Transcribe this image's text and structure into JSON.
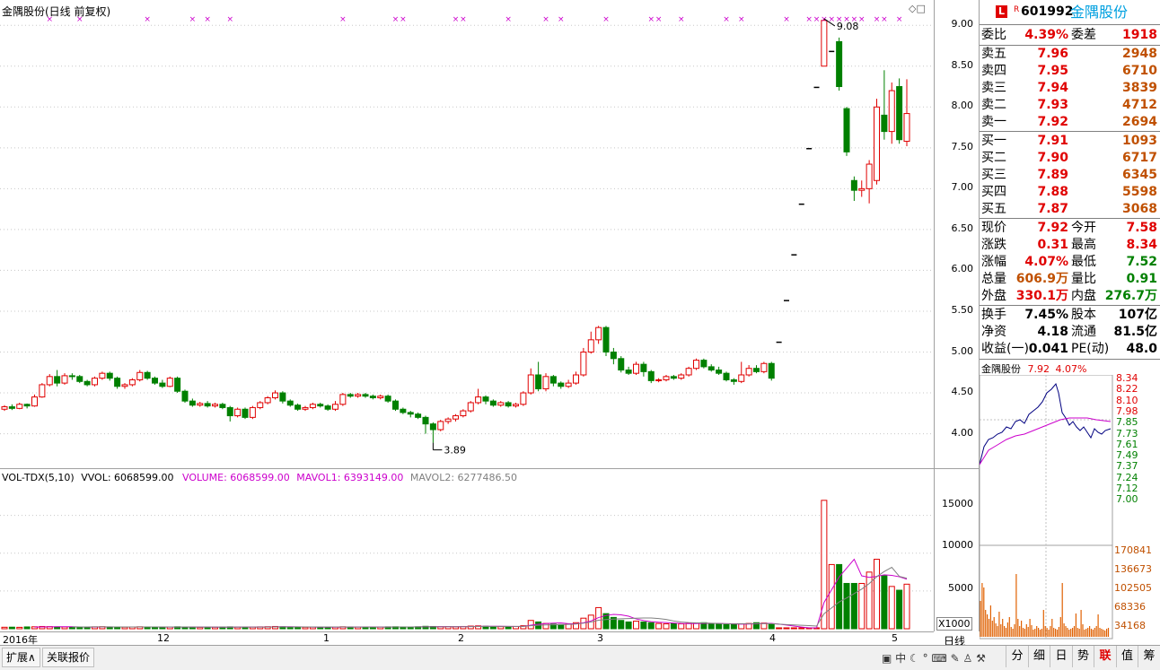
{
  "chart_title": "金隅股份(日线 前复权)",
  "price_axis": [
    "9.00",
    "8.50",
    "8.00",
    "7.50",
    "7.00",
    "6.50",
    "6.00",
    "5.50",
    "5.00",
    "4.50",
    "4.00"
  ],
  "annotations": {
    "high": "9.08",
    "low": "3.89"
  },
  "volume_header": {
    "name": "VOL-TDX(5,10)",
    "vvol": "VVOL: 6068599.00",
    "volume": "VOLUME: 6068599.00",
    "mavol1": "MAVOL1: 6393149.00",
    "mavol2": "MAVOL2: 6277486.50"
  },
  "volume_axis": [
    "15000",
    "10000",
    "5000"
  ],
  "volume_unit": "X1000",
  "date_axis": [
    "2016年",
    "12",
    "1",
    "2",
    "3",
    "4",
    "5"
  ],
  "period_label": "日线",
  "quote": {
    "badge": "L",
    "r_mark": "R",
    "code": "601992",
    "name": "金隅股份",
    "webi_label": "委比",
    "webi": "4.39%",
    "wecha_label": "委差",
    "wecha": "1918",
    "asks": [
      {
        "label": "卖五",
        "price": "7.96",
        "vol": "2948"
      },
      {
        "label": "卖四",
        "price": "7.95",
        "vol": "6710"
      },
      {
        "label": "卖三",
        "price": "7.94",
        "vol": "3839"
      },
      {
        "label": "卖二",
        "price": "7.93",
        "vol": "4712"
      },
      {
        "label": "卖一",
        "price": "7.92",
        "vol": "2694"
      }
    ],
    "bids": [
      {
        "label": "买一",
        "price": "7.91",
        "vol": "1093"
      },
      {
        "label": "买二",
        "price": "7.90",
        "vol": "6717"
      },
      {
        "label": "买三",
        "price": "7.89",
        "vol": "6345"
      },
      {
        "label": "买四",
        "price": "7.88",
        "vol": "5598"
      },
      {
        "label": "买五",
        "price": "7.87",
        "vol": "3068"
      }
    ],
    "stats": [
      {
        "l1": "现价",
        "v1": "7.92",
        "c1": "red",
        "l2": "今开",
        "v2": "7.58",
        "c2": "red"
      },
      {
        "l1": "涨跌",
        "v1": "0.31",
        "c1": "red",
        "l2": "最高",
        "v2": "8.34",
        "c2": "red"
      },
      {
        "l1": "涨幅",
        "v1": "4.07%",
        "c1": "red",
        "l2": "最低",
        "v2": "7.52",
        "c2": "green"
      },
      {
        "l1": "总量",
        "v1": "606.9万",
        "c1": "orange",
        "l2": "量比",
        "v2": "0.91",
        "c2": "green"
      },
      {
        "l1": "外盘",
        "v1": "330.1万",
        "c1": "red",
        "l2": "内盘",
        "v2": "276.7万",
        "c2": "green"
      }
    ],
    "stats2": [
      {
        "l1": "换手",
        "v1": "7.45%",
        "l2": "股本",
        "v2": "107亿"
      },
      {
        "l1": "净资",
        "v1": "4.18",
        "l2": "流通",
        "v2": "81.5亿"
      },
      {
        "l1": "收益(一)",
        "v1": "0.041",
        "l2": "PE(动)",
        "v2": "48.0"
      }
    ]
  },
  "mini": {
    "title": "金隅股份",
    "price": "7.92",
    "pct": "4.07%",
    "price_axis": [
      "8.34",
      "8.22",
      "8.10",
      "7.98",
      "7.85",
      "7.73",
      "7.61",
      "7.49",
      "7.37",
      "7.24",
      "7.12",
      "7.00"
    ],
    "vol_axis": [
      "170841",
      "136673",
      "102505",
      "68336",
      "34168"
    ]
  },
  "bottom_tabs": [
    "扩展∧",
    "关联报价"
  ],
  "right_tabs": [
    "分",
    "细",
    "日",
    "势",
    "联",
    "值",
    "筹"
  ],
  "colors": {
    "up": "#e00000",
    "down": "#008000",
    "ma1": "#cc00cc",
    "ma2": "#808080",
    "star": "#cc00cc"
  },
  "chart_data": {
    "type": "candlestick",
    "title": "金隅股份(日线 前复权)",
    "ylim": [
      3.6,
      9.2
    ],
    "x_labels": [
      "2016年",
      "12",
      "1",
      "2",
      "3",
      "4",
      "5"
    ],
    "candles": [
      [
        4.3,
        4.33,
        4.28,
        4.35
      ],
      [
        4.33,
        4.31,
        4.29,
        4.36
      ],
      [
        4.31,
        4.36,
        4.3,
        4.38
      ],
      [
        4.36,
        4.34,
        4.31,
        4.37
      ],
      [
        4.34,
        4.45,
        4.33,
        4.48
      ],
      [
        4.45,
        4.6,
        4.44,
        4.62
      ],
      [
        4.6,
        4.7,
        4.58,
        4.73
      ],
      [
        4.7,
        4.62,
        4.58,
        4.78
      ],
      [
        4.62,
        4.71,
        4.6,
        4.74
      ],
      [
        4.71,
        4.7,
        4.66,
        4.74
      ],
      [
        4.7,
        4.64,
        4.62,
        4.72
      ],
      [
        4.64,
        4.6,
        4.58,
        4.66
      ],
      [
        4.6,
        4.68,
        4.58,
        4.7
      ],
      [
        4.68,
        4.74,
        4.66,
        4.76
      ],
      [
        4.74,
        4.68,
        4.65,
        4.76
      ],
      [
        4.68,
        4.58,
        4.55,
        4.7
      ],
      [
        4.58,
        4.6,
        4.55,
        4.62
      ],
      [
        4.6,
        4.66,
        4.58,
        4.68
      ],
      [
        4.66,
        4.75,
        4.64,
        4.78
      ],
      [
        4.75,
        4.68,
        4.66,
        4.77
      ],
      [
        4.68,
        4.62,
        4.6,
        4.7
      ],
      [
        4.62,
        4.58,
        4.56,
        4.66
      ],
      [
        4.58,
        4.68,
        4.57,
        4.7
      ],
      [
        4.68,
        4.52,
        4.5,
        4.7
      ],
      [
        4.52,
        4.4,
        4.38,
        4.54
      ],
      [
        4.4,
        4.35,
        4.33,
        4.43
      ],
      [
        4.35,
        4.37,
        4.33,
        4.39
      ],
      [
        4.37,
        4.34,
        4.32,
        4.4
      ],
      [
        4.34,
        4.36,
        4.32,
        4.38
      ],
      [
        4.36,
        4.32,
        4.3,
        4.38
      ],
      [
        4.32,
        4.22,
        4.15,
        4.34
      ],
      [
        4.22,
        4.3,
        4.2,
        4.32
      ],
      [
        4.3,
        4.2,
        4.18,
        4.32
      ],
      [
        4.2,
        4.32,
        4.18,
        4.34
      ],
      [
        4.32,
        4.38,
        4.3,
        4.4
      ],
      [
        4.38,
        4.44,
        4.36,
        4.46
      ],
      [
        4.44,
        4.5,
        4.42,
        4.53
      ],
      [
        4.5,
        4.4,
        4.37,
        4.52
      ],
      [
        4.4,
        4.35,
        4.33,
        4.42
      ],
      [
        4.35,
        4.3,
        4.28,
        4.37
      ],
      [
        4.3,
        4.32,
        4.28,
        4.34
      ],
      [
        4.32,
        4.36,
        4.3,
        4.38
      ],
      [
        4.36,
        4.34,
        4.32,
        4.38
      ],
      [
        4.34,
        4.3,
        4.28,
        4.36
      ],
      [
        4.3,
        4.36,
        4.28,
        4.4
      ],
      [
        4.36,
        4.48,
        4.34,
        4.5
      ],
      [
        4.48,
        4.46,
        4.44,
        4.5
      ],
      [
        4.46,
        4.48,
        4.44,
        4.5
      ],
      [
        4.48,
        4.46,
        4.44,
        4.5
      ],
      [
        4.46,
        4.44,
        4.42,
        4.48
      ],
      [
        4.44,
        4.46,
        4.42,
        4.48
      ],
      [
        4.46,
        4.4,
        4.38,
        4.48
      ],
      [
        4.4,
        4.3,
        4.28,
        4.42
      ],
      [
        4.3,
        4.26,
        4.24,
        4.32
      ],
      [
        4.26,
        4.24,
        4.2,
        4.28
      ],
      [
        4.24,
        4.2,
        4.18,
        4.26
      ],
      [
        4.2,
        4.12,
        4.0,
        4.22
      ],
      [
        4.12,
        4.05,
        3.89,
        4.14
      ],
      [
        4.05,
        4.15,
        4.03,
        4.17
      ],
      [
        4.15,
        4.18,
        4.12,
        4.2
      ],
      [
        4.18,
        4.22,
        4.15,
        4.24
      ],
      [
        4.22,
        4.28,
        4.2,
        4.3
      ],
      [
        4.28,
        4.38,
        4.26,
        4.4
      ],
      [
        4.38,
        4.45,
        4.36,
        4.55
      ],
      [
        4.45,
        4.4,
        4.36,
        4.47
      ],
      [
        4.4,
        4.35,
        4.33,
        4.42
      ],
      [
        4.35,
        4.38,
        4.33,
        4.4
      ],
      [
        4.38,
        4.34,
        4.32,
        4.4
      ],
      [
        4.34,
        4.36,
        4.32,
        4.38
      ],
      [
        4.36,
        4.5,
        4.34,
        4.52
      ],
      [
        4.5,
        4.72,
        4.48,
        4.8
      ],
      [
        4.72,
        4.55,
        4.52,
        4.88
      ],
      [
        4.55,
        4.7,
        4.52,
        4.74
      ],
      [
        4.7,
        4.62,
        4.58,
        4.72
      ],
      [
        4.62,
        4.58,
        4.55,
        4.64
      ],
      [
        4.58,
        4.62,
        4.56,
        4.66
      ],
      [
        4.62,
        4.72,
        4.6,
        4.76
      ],
      [
        4.72,
        5.0,
        4.7,
        5.05
      ],
      [
        5.0,
        5.15,
        4.98,
        5.25
      ],
      [
        5.15,
        5.3,
        5.1,
        5.32
      ],
      [
        5.3,
        5.0,
        4.95,
        5.32
      ],
      [
        5.0,
        4.92,
        4.85,
        5.05
      ],
      [
        4.92,
        4.78,
        4.75,
        4.95
      ],
      [
        4.78,
        4.74,
        4.72,
        4.82
      ],
      [
        4.74,
        4.85,
        4.72,
        4.88
      ],
      [
        4.85,
        4.76,
        4.7,
        4.88
      ],
      [
        4.76,
        4.65,
        4.62,
        4.78
      ],
      [
        4.65,
        4.66,
        4.63,
        4.68
      ],
      [
        4.66,
        4.7,
        4.64,
        4.72
      ],
      [
        4.7,
        4.68,
        4.66,
        4.72
      ],
      [
        4.68,
        4.72,
        4.66,
        4.74
      ],
      [
        4.72,
        4.8,
        4.7,
        4.82
      ],
      [
        4.8,
        4.9,
        4.78,
        4.92
      ],
      [
        4.9,
        4.82,
        4.8,
        4.92
      ],
      [
        4.82,
        4.78,
        4.76,
        4.85
      ],
      [
        4.78,
        4.74,
        4.72,
        4.82
      ],
      [
        4.74,
        4.66,
        4.64,
        4.76
      ],
      [
        4.66,
        4.64,
        4.6,
        4.68
      ],
      [
        4.64,
        4.72,
        4.62,
        4.88
      ],
      [
        4.72,
        4.8,
        4.7,
        4.84
      ],
      [
        4.8,
        4.76,
        4.74,
        4.84
      ],
      [
        4.76,
        4.86,
        4.74,
        4.88
      ],
      [
        4.86,
        4.68,
        4.65,
        4.88
      ],
      [
        5.12,
        5.12,
        5.12,
        5.12
      ],
      [
        5.63,
        5.63,
        5.63,
        5.63
      ],
      [
        6.19,
        6.19,
        6.19,
        6.19
      ],
      [
        6.81,
        6.81,
        6.81,
        6.81
      ],
      [
        7.49,
        7.49,
        7.49,
        7.49
      ],
      [
        8.24,
        8.24,
        8.24,
        8.24
      ],
      [
        8.5,
        9.06,
        8.5,
        9.08
      ],
      [
        8.68,
        8.68,
        8.68,
        8.68
      ],
      [
        8.8,
        8.25,
        8.2,
        8.85
      ],
      [
        7.98,
        7.45,
        7.4,
        8.0
      ],
      [
        7.1,
        6.98,
        6.85,
        7.15
      ],
      [
        6.98,
        7.0,
        6.9,
        7.1
      ],
      [
        7.0,
        7.3,
        6.82,
        7.35
      ],
      [
        7.1,
        8.0,
        7.05,
        8.1
      ],
      [
        7.9,
        7.7,
        7.6,
        8.45
      ],
      [
        7.7,
        8.2,
        7.55,
        8.3
      ],
      [
        8.25,
        7.6,
        7.55,
        8.35
      ],
      [
        7.58,
        7.92,
        7.52,
        8.34
      ]
    ],
    "volume": [
      200,
      210,
      190,
      240,
      260,
      300,
      280,
      250,
      240,
      230,
      200,
      210,
      250,
      270,
      240,
      230,
      210,
      230,
      260,
      240,
      220,
      200,
      230,
      260,
      230,
      210,
      190,
      200,
      210,
      220,
      250,
      220,
      200,
      230,
      250,
      270,
      300,
      260,
      230,
      210,
      200,
      220,
      210,
      190,
      230,
      260,
      240,
      230,
      220,
      210,
      230,
      250,
      260,
      240,
      230,
      260,
      320,
      300,
      270,
      290,
      260,
      300,
      350,
      380,
      330,
      300,
      280,
      290,
      300,
      400,
      1100,
      900,
      700,
      600,
      550,
      600,
      800,
      1400,
      1800,
      2800,
      2000,
      1500,
      1100,
      900,
      1000,
      900,
      800,
      700,
      650,
      700,
      650,
      700,
      750,
      800,
      650,
      600,
      550,
      600,
      650,
      700,
      800,
      750,
      650,
      120,
      120,
      120,
      120,
      120,
      120,
      17000,
      8500,
      8500,
      6000,
      6000,
      6000,
      7500,
      9200,
      7000,
      5600,
      5100,
      5900
    ],
    "volume_unit": "X1000"
  }
}
